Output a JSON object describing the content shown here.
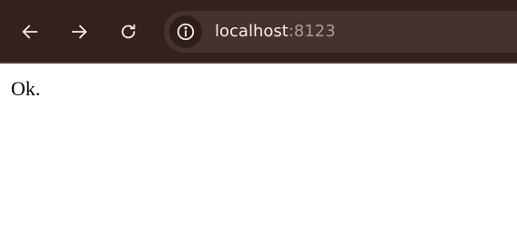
{
  "toolbar": {
    "back_icon": "arrow-left-icon",
    "forward_icon": "arrow-right-icon",
    "reload_icon": "reload-icon",
    "site_info_icon": "info-circle-icon",
    "address": {
      "host": "localhost",
      "port": ":8123"
    }
  },
  "page": {
    "body_text": "Ok."
  },
  "colors": {
    "toolbar_bg": "#35211c",
    "omnibox_bg": "#45322d",
    "url_host": "#f2ecea",
    "url_port": "#a89c98",
    "page_bg": "#ffffff"
  }
}
